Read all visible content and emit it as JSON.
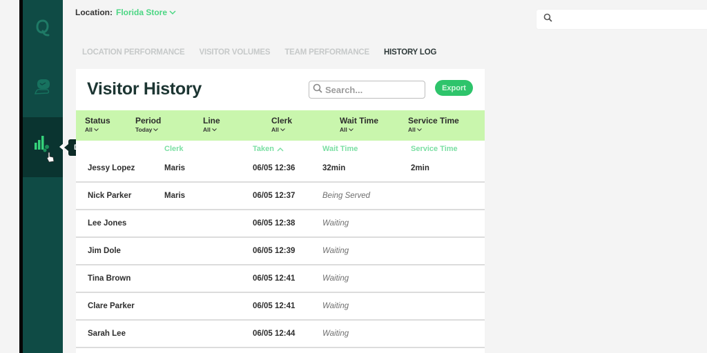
{
  "location": {
    "label": "Location:",
    "value": "Florida Store"
  },
  "sidebar": {
    "items": [
      {
        "name": "q-logo",
        "active": false
      },
      {
        "name": "chat",
        "active": false
      },
      {
        "name": "data-insights",
        "active": true,
        "tooltip": "Data Insights"
      }
    ]
  },
  "tabs": [
    {
      "label": "LOCATION PERFORMANCE",
      "active": false
    },
    {
      "label": "VISITOR VOLUMES",
      "active": false
    },
    {
      "label": "TEAM PERFORMANCE",
      "active": false
    },
    {
      "label": "HISTORY LOG",
      "active": true
    }
  ],
  "top_search": {
    "placeholder": "",
    "value": ""
  },
  "card": {
    "title": "Visitor History",
    "search_placeholder": "Search...",
    "export_label": "Export"
  },
  "filters": [
    {
      "label": "Status",
      "value": "All"
    },
    {
      "label": "Period",
      "value": "Today"
    },
    {
      "label": "Line",
      "value": "All"
    },
    {
      "label": "Clerk",
      "value": "All"
    },
    {
      "label": "Wait Time",
      "value": "All"
    },
    {
      "label": "Service Time",
      "value": "All"
    }
  ],
  "columns": {
    "clerk": "Clerk",
    "taken": "Taken",
    "wait": "Wait Time",
    "service": "Service Time"
  },
  "rows": [
    {
      "name": "Jessy Lopez",
      "clerk": "Maris",
      "taken": "06/05 12:36",
      "wait": "32min",
      "service": "2min"
    },
    {
      "name": "Nick Parker",
      "clerk": "Maris",
      "taken": "06/05 12:37",
      "wait": "Being Served",
      "service": ""
    },
    {
      "name": "Lee Jones",
      "clerk": "",
      "taken": "06/05 12:38",
      "wait": "Waiting",
      "service": ""
    },
    {
      "name": "Jim Dole",
      "clerk": "",
      "taken": "06/05 12:39",
      "wait": "Waiting",
      "service": ""
    },
    {
      "name": "Tina Brown",
      "clerk": "",
      "taken": "06/05 12:41",
      "wait": "Waiting",
      "service": ""
    },
    {
      "name": "Clare Parker",
      "clerk": "",
      "taken": "06/05 12:41",
      "wait": "Waiting",
      "service": ""
    },
    {
      "name": "Sarah Lee",
      "clerk": "",
      "taken": "06/05 12:44",
      "wait": "Waiting",
      "service": ""
    }
  ],
  "colors": {
    "sidebar": "#0f4b45",
    "sidebar_active": "#0a3430",
    "accent_green": "#2ec46b",
    "filter_bar": "#c9f6ad",
    "column_header": "#7bdfa3",
    "location_value": "#4bd683"
  }
}
